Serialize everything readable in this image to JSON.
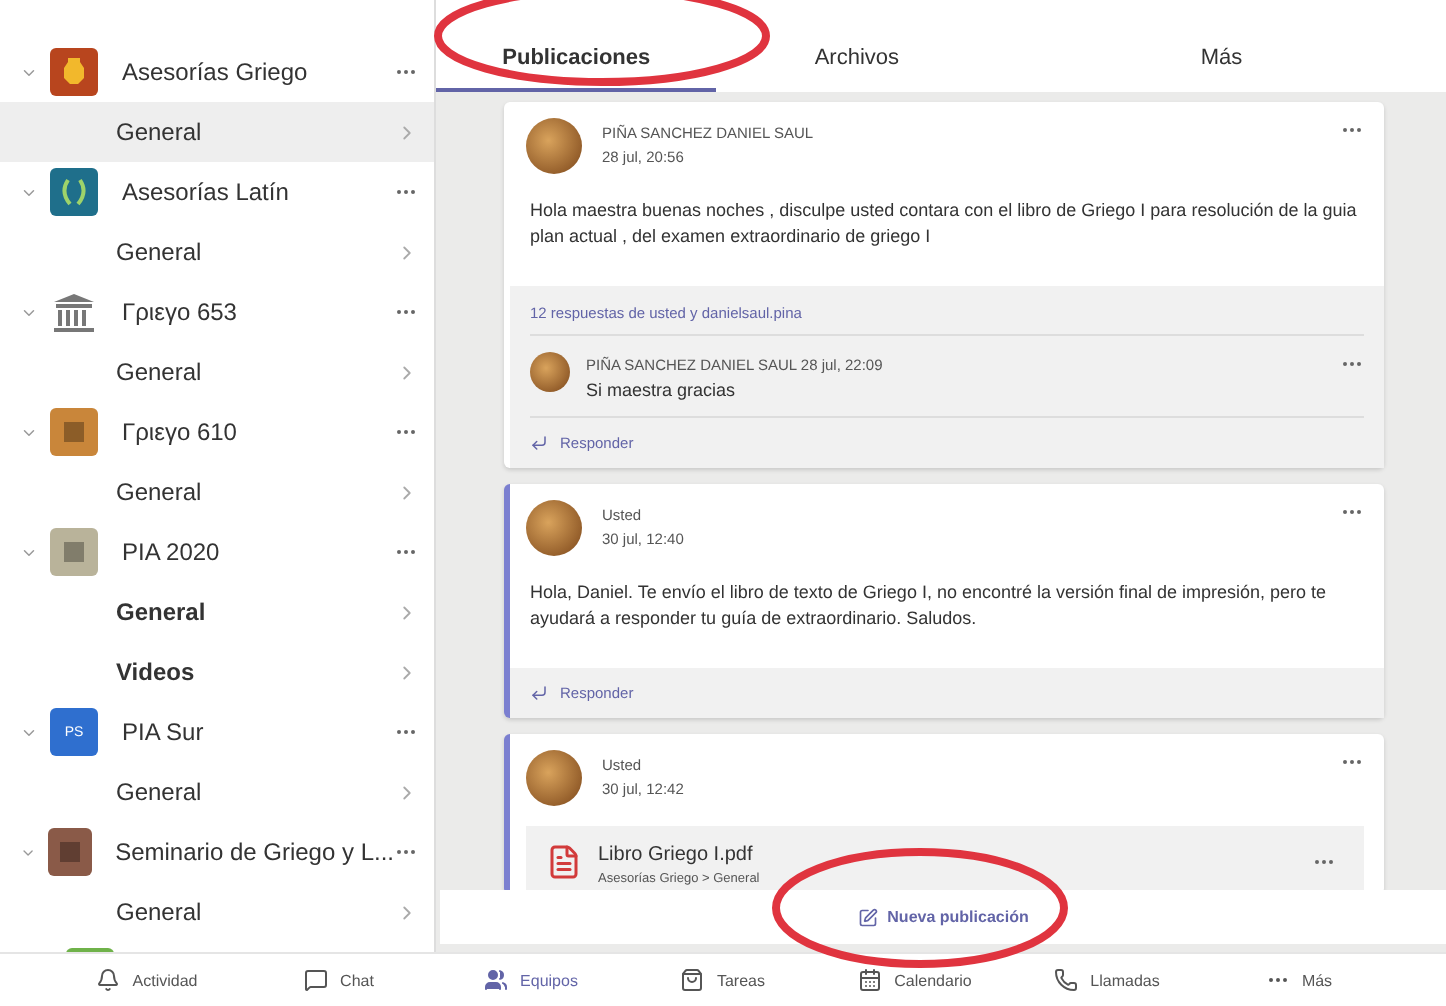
{
  "sidebar": {
    "teams": [
      {
        "name": "Asesorías Griego",
        "channels": [
          {
            "name": "General",
            "selected": true,
            "bold": false
          }
        ]
      },
      {
        "name": "Asesorías Latín",
        "channels": [
          {
            "name": "General",
            "selected": false,
            "bold": false
          }
        ]
      },
      {
        "name": "Γριεγο 653",
        "channels": [
          {
            "name": "General",
            "selected": false,
            "bold": false
          }
        ]
      },
      {
        "name": "Γριεγο 610",
        "channels": [
          {
            "name": "General",
            "selected": false,
            "bold": false
          }
        ]
      },
      {
        "name": "PIA 2020",
        "channels": [
          {
            "name": "General",
            "selected": false,
            "bold": true
          },
          {
            "name": "Videos",
            "selected": false,
            "bold": true
          }
        ]
      },
      {
        "name": "PIA Sur",
        "initials": "PS",
        "channels": [
          {
            "name": "General",
            "selected": false,
            "bold": false
          }
        ]
      },
      {
        "name": "Seminario de Griego y L...",
        "channels": [
          {
            "name": "General",
            "selected": false,
            "bold": false
          }
        ]
      }
    ]
  },
  "tabs": [
    {
      "label": "Publicaciones",
      "selected": true
    },
    {
      "label": "Archivos",
      "selected": false
    },
    {
      "label": "Más",
      "selected": false
    }
  ],
  "posts": [
    {
      "author": "PIÑA SANCHEZ DANIEL SAUL",
      "time": "28 jul, 20:56",
      "mine": false,
      "text": "Hola maestra buenas noches ,  disculpe usted contara con el libro de Griego I para resolución de la guia plan actual , del examen extraordinario de griego I",
      "replies_summary": "12 respuestas de usted y danielsaul.pina",
      "replies": [
        {
          "author": "PIÑA SANCHEZ DANIEL SAUL",
          "time": "28 jul, 22:09",
          "text": "Si maestra gracias"
        }
      ],
      "reply_action": "Responder"
    },
    {
      "author": "Usted",
      "time": "30 jul, 12:40",
      "mine": true,
      "text": "Hola, Daniel. Te envío el libro de texto de Griego I, no encontré la versión final de impresión, pero te ayudará a responder tu guía de extraordinario. Saludos.",
      "reply_action": "Responder"
    },
    {
      "author": "Usted",
      "time": "30 jul, 12:42",
      "mine": true,
      "attachment": {
        "name": "Libro Griego I.pdf",
        "path": "Asesorías Griego > General"
      }
    }
  ],
  "new_post": {
    "label": "Nueva publicación"
  },
  "annotations": [
    {
      "kind": "ellipse"
    },
    {
      "kind": "ellipse"
    }
  ],
  "bottom_nav": [
    {
      "label": "Actividad",
      "selected": false
    },
    {
      "label": "Chat",
      "selected": false
    },
    {
      "label": "Equipos",
      "selected": true
    },
    {
      "label": "Tareas",
      "selected": false
    },
    {
      "label": "Calendario",
      "selected": false
    },
    {
      "label": "Llamadas",
      "selected": false
    },
    {
      "label": "Más",
      "selected": false
    }
  ]
}
